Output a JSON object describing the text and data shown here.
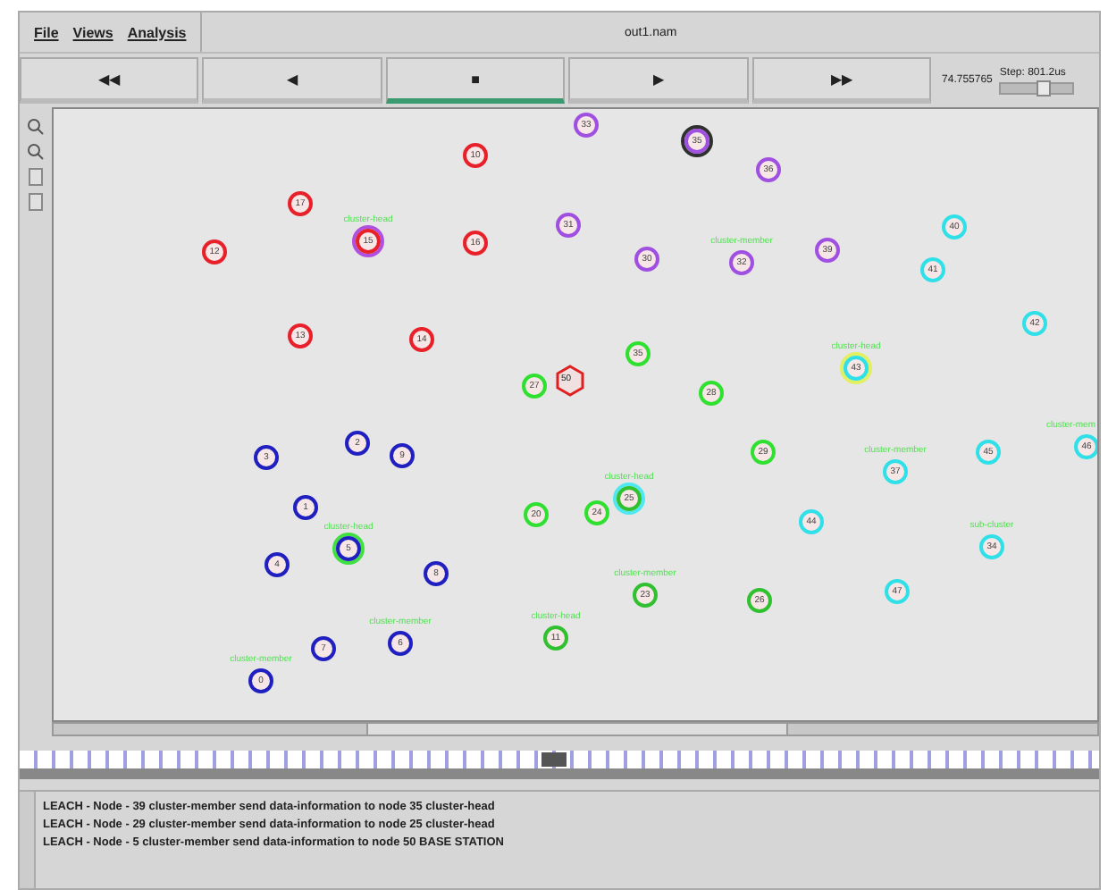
{
  "menu": [
    {
      "label": "File"
    },
    {
      "label": "Views"
    },
    {
      "label": "Analysis"
    }
  ],
  "window": {
    "title": "out1.nam"
  },
  "controls": [
    {
      "label": "◀◀",
      "selected": false
    },
    {
      "label": "◀",
      "selected": false
    },
    {
      "label": "■",
      "selected": true
    },
    {
      "label": "▶",
      "selected": false
    },
    {
      "label": "▶▶",
      "selected": false
    }
  ],
  "time": "74.755765",
  "step": {
    "label": "Step: 801.2us",
    "level": 0.6
  },
  "nodes": [
    {
      "label": "12",
      "color": "#e8202a",
      "kind": "node"
    },
    {
      "label": "17",
      "color": "#e8202a",
      "kind": "node"
    },
    {
      "label": "15",
      "color": "#e8202a",
      "kind": "node",
      "ring": {
        "color": "#b050e0"
      },
      "tag": "cluster-head"
    },
    {
      "label": "16",
      "color": "#e8202a",
      "kind": "node"
    },
    {
      "label": "10",
      "color": "#e8202a",
      "kind": "node"
    },
    {
      "label": "13",
      "color": "#e8202a",
      "kind": "node"
    },
    {
      "label": "14",
      "color": "#e8202a",
      "kind": "node"
    },
    {
      "label": "33",
      "color": "#a050e0",
      "kind": "node"
    },
    {
      "label": "35",
      "color": "#a050e0",
      "kind": "node",
      "ring": {
        "color": "#303030"
      }
    },
    {
      "label": "36",
      "color": "#a050e0",
      "kind": "node"
    },
    {
      "label": "31",
      "color": "#a050e0",
      "kind": "node"
    },
    {
      "label": "30",
      "color": "#a050e0",
      "kind": "node"
    },
    {
      "label": "32",
      "color": "#a050e0",
      "kind": "node",
      "tag": "cluster-member"
    },
    {
      "label": "39",
      "color": "#a050e0",
      "kind": "node"
    },
    {
      "label": "40",
      "color": "#30e0e8",
      "kind": "node"
    },
    {
      "label": "41",
      "color": "#30e0e8",
      "kind": "node"
    },
    {
      "label": "42",
      "color": "#30e0e8",
      "kind": "node"
    },
    {
      "label": "43",
      "color": "#30e0e8",
      "kind": "node",
      "ring": {
        "color": "#e0f060"
      },
      "tag": "cluster-head"
    },
    {
      "label": "37",
      "color": "#30e0e8",
      "kind": "node",
      "tag": "cluster-member"
    },
    {
      "label": "45",
      "color": "#30e0e8",
      "kind": "node"
    },
    {
      "label": "46",
      "color": "#30e0e8",
      "kind": "node",
      "tag": "cluster-mem"
    },
    {
      "label": "44",
      "color": "#30e0e8",
      "kind": "node"
    },
    {
      "label": "34",
      "color": "#30e0e8",
      "kind": "node",
      "tag": "sub-cluster"
    },
    {
      "label": "47",
      "color": "#30e0e8",
      "kind": "node"
    },
    {
      "label": "27",
      "color": "#30e030",
      "kind": "node"
    },
    {
      "label": "50",
      "color": "#e02020",
      "kind": "base_station"
    },
    {
      "label": "35",
      "color": "#30e030",
      "kind": "node"
    },
    {
      "label": "28",
      "color": "#30e030",
      "kind": "node"
    },
    {
      "label": "29",
      "color": "#30e030",
      "kind": "node"
    },
    {
      "label": "20",
      "color": "#30e030",
      "kind": "node"
    },
    {
      "label": "24",
      "color": "#30e030",
      "kind": "node"
    },
    {
      "label": "25",
      "color": "#30c030",
      "kind": "node",
      "ring": {
        "color": "#50e8f0"
      },
      "tag": "cluster-head"
    },
    {
      "label": "23",
      "color": "#30c030",
      "kind": "node",
      "tag": "cluster-member"
    },
    {
      "label": "26",
      "color": "#30c030",
      "kind": "node"
    },
    {
      "label": "11",
      "color": "#30c030",
      "kind": "node",
      "tag": "cluster-head"
    },
    {
      "label": "3",
      "color": "#2020c0",
      "kind": "node"
    },
    {
      "label": "2",
      "color": "#2020c0",
      "kind": "node"
    },
    {
      "label": "9",
      "color": "#2020c0",
      "kind": "node"
    },
    {
      "label": "1",
      "color": "#2020c0",
      "kind": "node"
    },
    {
      "label": "5",
      "color": "#2020c0",
      "kind": "node",
      "ring": {
        "color": "#40e040"
      },
      "tag": "cluster-head"
    },
    {
      "label": "4",
      "color": "#2020c0",
      "kind": "node"
    },
    {
      "label": "8",
      "color": "#2020c0",
      "kind": "node"
    },
    {
      "label": "7",
      "color": "#2020c0",
      "kind": "node"
    },
    {
      "label": "6",
      "color": "#2020c0",
      "kind": "node",
      "tag": "cluster-member"
    },
    {
      "label": "0",
      "color": "#2020c0",
      "kind": "node",
      "tag": "cluster-member"
    }
  ],
  "log": [
    "LEACH - Node - 39 cluster-member send data-information to node 35 cluster-head",
    "LEACH - Node - 29 cluster-member send data-information to node 25 cluster-head",
    "LEACH - Node - 5 cluster-member send data-information to node 50 BASE STATION"
  ]
}
